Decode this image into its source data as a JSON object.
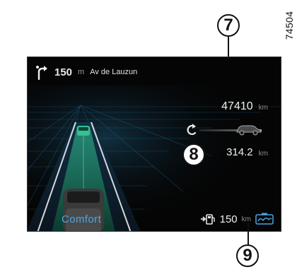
{
  "reference_code": "74504",
  "callouts": {
    "odometer": "7",
    "range": "8",
    "fuel_indicator": "9"
  },
  "navigation": {
    "distance": "150",
    "unit": "m",
    "street": "Av de Lauzun",
    "icon": "turn-right-icon"
  },
  "odometer": {
    "value": "47410",
    "unit": "km"
  },
  "range": {
    "value": "314.2",
    "unit": "km",
    "icon": "car-icon"
  },
  "drive_mode": {
    "label": "Comfort"
  },
  "fuel": {
    "value": "150",
    "unit": "km",
    "icon": "fuel-pump-icon",
    "eco_icon": "eco-mode-icon"
  },
  "colors": {
    "background": "#050505",
    "accent_blue": "#46a7e8",
    "lane_green": "#1f8b6f",
    "text_primary": "#f0f0f0",
    "text_secondary": "#8a8a8a"
  }
}
